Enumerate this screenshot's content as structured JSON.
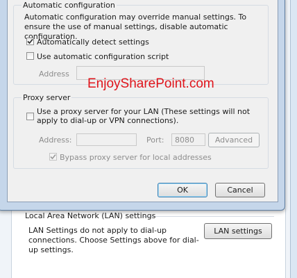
{
  "auto_config": {
    "legend": "Automatic configuration",
    "description": "Automatic configuration may override manual settings.  To ensure the use of manual settings, disable automatic configuration.",
    "auto_detect_label": "Automatically detect settings",
    "auto_detect_checked": true,
    "use_script_label": "Use automatic configuration script",
    "use_script_checked": false,
    "address_label": "Address",
    "address_value": ""
  },
  "proxy": {
    "legend": "Proxy server",
    "use_proxy_label": "Use a proxy server for your LAN (These settings will not apply to dial-up or VPN connections).",
    "use_proxy_checked": false,
    "address_label": "Address:",
    "address_value": "",
    "port_label": "Port:",
    "port_value": "8080",
    "advanced_label": "Advanced",
    "bypass_label": "Bypass proxy server for local addresses",
    "bypass_checked": true
  },
  "dialog_buttons": {
    "ok_label": "OK",
    "cancel_label": "Cancel"
  },
  "lan_section": {
    "legend": "Local Area Network (LAN) settings",
    "description": "LAN Settings do not apply to dial-up connections. Choose Settings above for dial-up settings.",
    "button_label": "LAN settings"
  },
  "watermark": "EnjoySharePoint.com"
}
